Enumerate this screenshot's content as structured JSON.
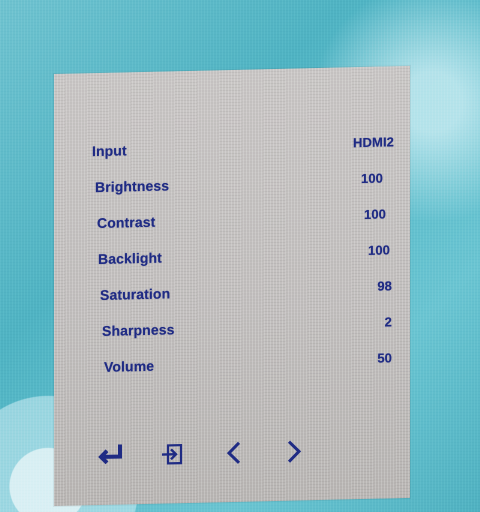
{
  "osd": {
    "items": [
      {
        "label": "Input",
        "value": "HDMI2"
      },
      {
        "label": "Brightness",
        "value": "100"
      },
      {
        "label": "Contrast",
        "value": "100"
      },
      {
        "label": "Backlight",
        "value": "100"
      },
      {
        "label": "Saturation",
        "value": "98"
      },
      {
        "label": "Sharpness",
        "value": "2"
      },
      {
        "label": "Volume",
        "value": "50"
      }
    ],
    "controls": [
      {
        "name": "enter-icon"
      },
      {
        "name": "exit-icon"
      },
      {
        "name": "chevron-left-icon"
      },
      {
        "name": "chevron-right-icon"
      }
    ],
    "colors": {
      "text": "#1f2b84",
      "panel": "#c2bfbe",
      "background": "#5dbccb"
    }
  }
}
